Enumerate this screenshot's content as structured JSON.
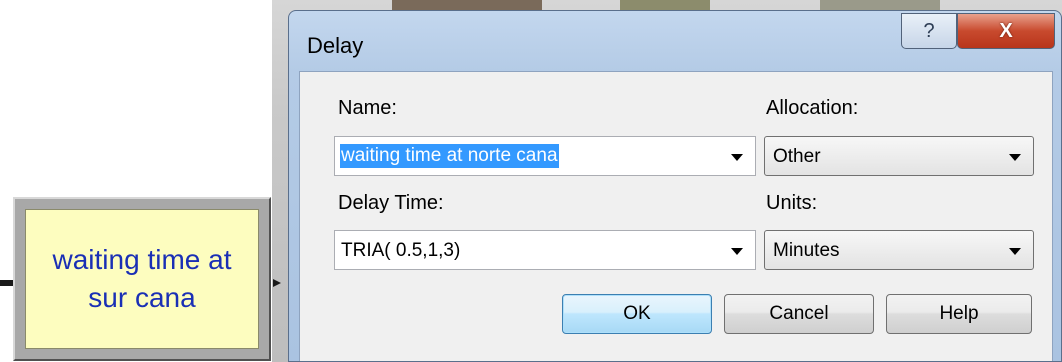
{
  "background_module": {
    "label": "waiting time at sur cana"
  },
  "dialog": {
    "title": "Delay",
    "help_glyph": "?",
    "close_glyph": "X",
    "fields": {
      "name_label": "Name:",
      "name_value": "waiting time at norte cana",
      "allocation_label": "Allocation:",
      "allocation_value": "Other",
      "delay_time_label": "Delay Time:",
      "delay_time_value": "TRIA( 0.5,1,3)",
      "units_label": "Units:",
      "units_value": "Minutes"
    },
    "buttons": {
      "ok": "OK",
      "cancel": "Cancel",
      "help": "Help"
    }
  },
  "colors": {
    "module_fill": "#fdfdbf",
    "module_text": "#1a2fb5",
    "selection": "#3399ff",
    "close_button": "#c84a2e"
  }
}
